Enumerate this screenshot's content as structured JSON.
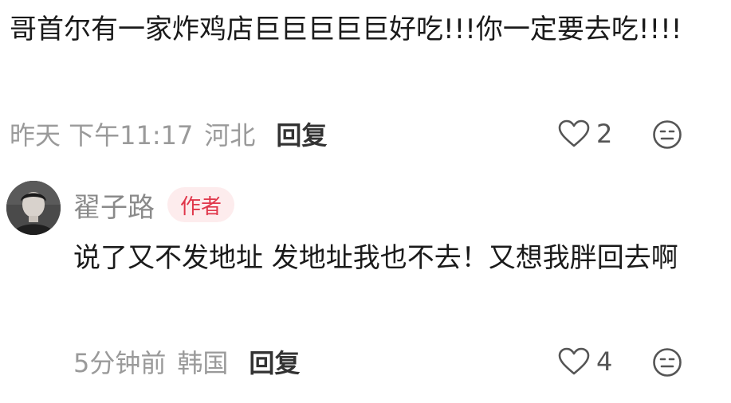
{
  "comment": {
    "text": "哥首尔有一家炸鸡店巨巨巨巨巨好吃!!!你一定要去吃!!!!",
    "timestamp": "昨天 下午11:17",
    "location": "河北",
    "reply_label": "回复",
    "like_count": "2",
    "like_icon": "heart-outline-icon",
    "dislike_icon": "meh-face-icon"
  },
  "reply": {
    "username": "翟子路",
    "badge": "作者",
    "text": "说了又不发地址 发地址我也不去！又想我胖回去啊",
    "timestamp": "5分钟前",
    "location": "韩国",
    "reply_label": "回复",
    "like_count": "4",
    "like_icon": "heart-outline-icon",
    "dislike_icon": "meh-face-icon"
  },
  "colors": {
    "meta_text": "#9a9a9a",
    "badge_bg": "#fdeced",
    "badge_text": "#e0364a",
    "body_text": "#1a1a1a"
  }
}
